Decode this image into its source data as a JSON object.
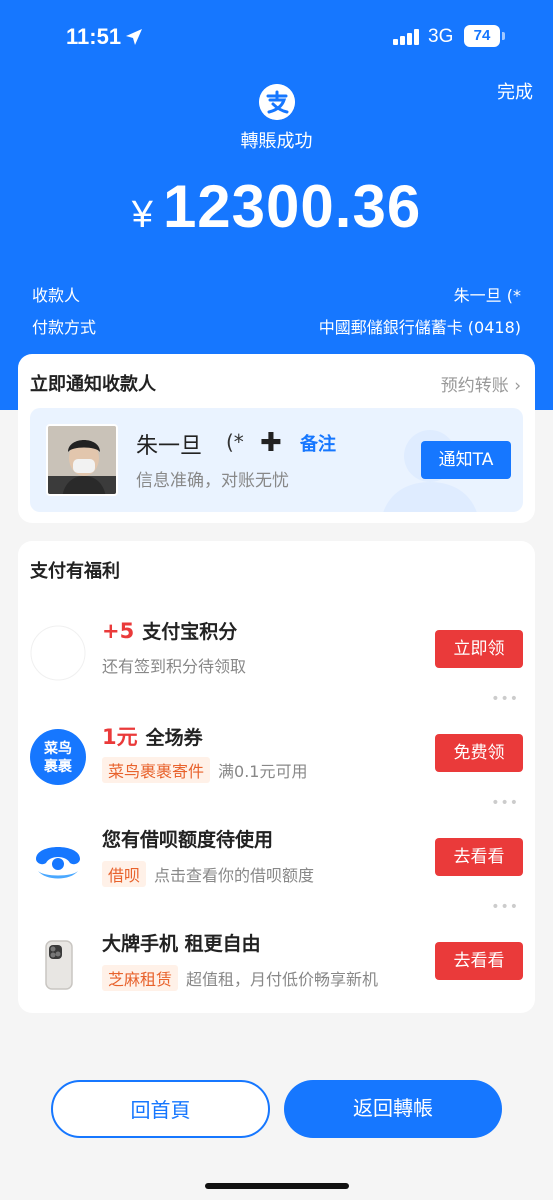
{
  "status_bar": {
    "time": "11:51",
    "network": "3G",
    "battery": "74"
  },
  "header": {
    "done_label": "完成",
    "logo_icon": "alipay-icon",
    "title": "轉賬成功",
    "currency": "¥",
    "amount": "12300.36"
  },
  "details": {
    "payee_label": "收款人",
    "payee_value": "朱一旦 (*",
    "method_label": "付款方式",
    "method_value": "中國郵儲銀行儲蓄卡 (0418)"
  },
  "notify_card": {
    "title": "立即通知收款人",
    "scheduled_link": "预约转账",
    "payee_name": "朱一旦",
    "payee_masked": "(*",
    "note_link": "备注",
    "description": "信息准确，对账无忧",
    "notify_button": "通知TA"
  },
  "benefits": {
    "title": "支付有福利",
    "items": [
      {
        "highlight": "+5",
        "title": "支付宝积分",
        "tag": "",
        "subtitle": "还有签到积分待领取",
        "button": "立即领",
        "icon": "points-icon"
      },
      {
        "highlight": "1元",
        "title": "全场券",
        "tag": "菜鸟裹裹寄件",
        "subtitle": "满0.1元可用",
        "button": "免费领",
        "icon": "cainiao-icon",
        "icon_text_top": "菜鸟",
        "icon_text_bottom": "裹裹"
      },
      {
        "highlight": "",
        "title": "您有借呗额度待使用",
        "tag": "借呗",
        "subtitle": "点击查看你的借呗额度",
        "button": "去看看",
        "icon": "jiebei-icon"
      },
      {
        "highlight": "",
        "title": "大牌手机 租更自由",
        "tag": "芝麻租赁",
        "subtitle": "超值租，月付低价畅享新机",
        "button": "去看看",
        "icon": "phone-icon"
      }
    ]
  },
  "bottom": {
    "home_button": "回首頁",
    "back_button": "返回轉帳"
  },
  "colors": {
    "brand_blue": "#1677ff",
    "red": "#ea3a3a",
    "tag_orange": "#e8622c"
  }
}
